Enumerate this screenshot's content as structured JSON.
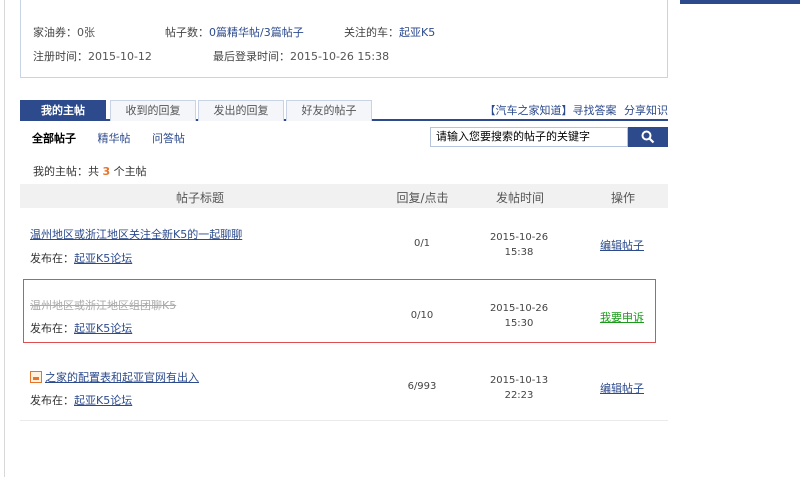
{
  "profile": {
    "coupon_label": "家油券：",
    "coupon_value": "0张",
    "posts_label": "帖子数：",
    "posts_value": "0篇精华帖/3篇帖子",
    "car_label": "关注的车：",
    "car_value": "起亚K5",
    "reg_label": "注册时间：",
    "reg_value": "2015-10-12",
    "login_label": "最后登录时间：",
    "login_value": "2015-10-26 15:38"
  },
  "tabs": [
    "我的主帖",
    "收到的回复",
    "发出的回复",
    "好友的帖子"
  ],
  "toplinks": {
    "zhidao": "【汽车之家知道】",
    "find": "寻找答案",
    "share": "分享知识"
  },
  "subtabs": [
    "全部帖子",
    "精华帖",
    "问答帖"
  ],
  "search": {
    "placeholder": "请输入您要搜索的帖子的关键字"
  },
  "summary": {
    "prefix": "我的主帖：共",
    "count": "3",
    "suffix": "个主帖"
  },
  "table": {
    "headers": [
      "帖子标题",
      "回复/点击",
      "发帖时间",
      "操作"
    ],
    "rows": [
      {
        "title": "温州地区或浙江地区关注全新K5的一起聊聊",
        "where_label": "发布在：",
        "forum": "起亚K5论坛",
        "replies": "0/1",
        "date": "2015-10-26",
        "time": "15:38",
        "action": "编辑帖子"
      },
      {
        "title": "温州地区或浙江地区组团聊K5",
        "where_label": "发布在：",
        "forum": "起亚K5论坛",
        "replies": "0/10",
        "date": "2015-10-26",
        "time": "15:30",
        "action": "我要申诉"
      },
      {
        "title": "之家的配置表和起亚官网有出入",
        "where_label": "发布在：",
        "forum": "起亚K5论坛",
        "replies": "6/993",
        "date": "2015-10-13",
        "time": "22:23",
        "action": "编辑帖子"
      }
    ]
  },
  "colors": {
    "brand": "#2c4a8c",
    "accent": "#e8732a",
    "appeal": "#1a9a1a",
    "highlight": "#e05050"
  }
}
